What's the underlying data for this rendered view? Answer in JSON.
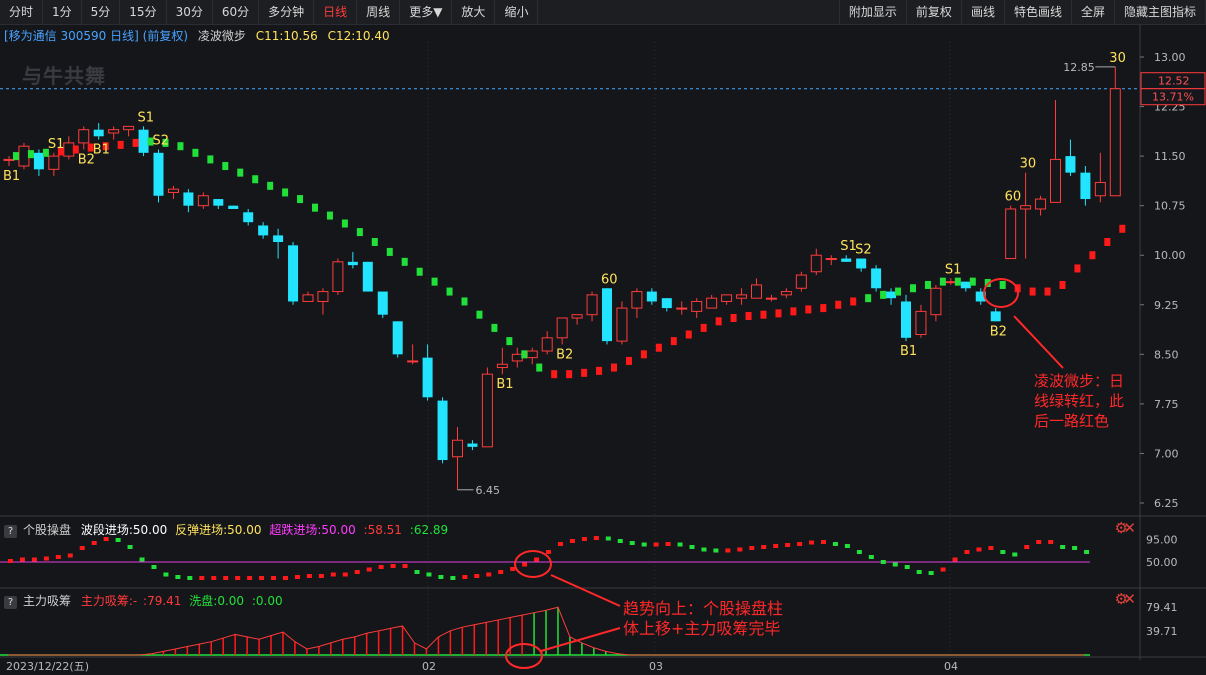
{
  "toolbar": {
    "left": [
      "分时",
      "1分",
      "5分",
      "15分",
      "30分",
      "60分",
      "多分钟",
      "日线",
      "周线",
      "更多▼",
      "放大",
      "缩小"
    ],
    "active": "日线",
    "right": [
      "附加显示",
      "前复权",
      "画线",
      "特色画线",
      "全屏",
      "隐藏主图指标"
    ]
  },
  "title": {
    "stock": "[移为通信 300590 日线]",
    "adjust": "(前复权)",
    "indicator": "凌波微步",
    "c1": "C11:10.56",
    "c2": "C12:10.40"
  },
  "watermark": "与牛共舞",
  "price_axis": {
    "ticks": [
      "13.00",
      "12.25",
      "11.50",
      "10.75",
      "10.00",
      "9.25",
      "8.50",
      "7.75",
      "7.00",
      "6.25"
    ],
    "current": "12.52",
    "change": "13.71%"
  },
  "labels": {
    "high": "12.85",
    "low": "6.45"
  },
  "annotations": {
    "main": [
      "凌波微步：日",
      "线绿转红，此",
      "后一路红色"
    ],
    "sub": [
      "趋势向上：个股操盘柱",
      "体上移+主力吸筹完毕"
    ]
  },
  "sub1": {
    "name": "个股操盘",
    "text1": "波段进场:50.00",
    "text2": "反弹进场:50.00",
    "text3": "超跌进场:50.00",
    "v1": ":58.51",
    "v2": ":62.89",
    "axis": [
      "95.00",
      "50.00"
    ]
  },
  "sub2": {
    "name": "主力吸筹",
    "text1": "主力吸筹:-",
    "v1": ":79.41",
    "text2": "洗盘:0.00",
    "v2": ":0.00",
    "axis": [
      "79.41",
      "39.71"
    ]
  },
  "date_axis": [
    "2023/12/22(五)",
    "02",
    "03",
    "04"
  ],
  "colors": {
    "up": "#ff3b3b",
    "down": "#22e4ff",
    "green": "#22e03a",
    "red": "#ff1a1a",
    "accent": "#ff3b3b"
  },
  "chart_data": [
    {
      "type": "candlestick",
      "title": "移为通信 300590 日线",
      "ylim": [
        6.25,
        13.0
      ],
      "ohlc": [
        [
          11.45,
          11.5,
          11.35,
          11.45
        ],
        [
          11.35,
          11.7,
          11.3,
          11.65
        ],
        [
          11.55,
          11.6,
          11.2,
          11.3
        ],
        [
          11.3,
          11.55,
          11.2,
          11.5
        ],
        [
          11.5,
          11.8,
          11.45,
          11.7
        ],
        [
          11.7,
          11.95,
          11.6,
          11.9
        ],
        [
          11.9,
          12.0,
          11.75,
          11.8
        ],
        [
          11.85,
          11.95,
          11.75,
          11.9
        ],
        [
          11.9,
          11.95,
          11.8,
          11.95
        ],
        [
          11.9,
          11.95,
          11.5,
          11.55
        ],
        [
          11.55,
          11.6,
          10.8,
          10.9
        ],
        [
          10.95,
          11.05,
          10.85,
          11.0
        ],
        [
          10.95,
          11.0,
          10.65,
          10.75
        ],
        [
          10.75,
          10.95,
          10.7,
          10.9
        ],
        [
          10.85,
          10.85,
          10.7,
          10.75
        ],
        [
          10.75,
          10.75,
          10.7,
          10.7
        ],
        [
          10.65,
          10.7,
          10.45,
          10.5
        ],
        [
          10.45,
          10.5,
          10.25,
          10.3
        ],
        [
          10.3,
          10.4,
          9.95,
          10.2
        ],
        [
          10.15,
          10.2,
          9.25,
          9.3
        ],
        [
          9.3,
          9.45,
          9.3,
          9.4
        ],
        [
          9.3,
          9.5,
          9.1,
          9.45
        ],
        [
          9.45,
          9.95,
          9.4,
          9.9
        ],
        [
          9.9,
          10.05,
          9.8,
          9.85
        ],
        [
          9.9,
          9.9,
          9.45,
          9.45
        ],
        [
          9.45,
          9.45,
          9.05,
          9.1
        ],
        [
          9.0,
          9.0,
          8.45,
          8.5
        ],
        [
          8.4,
          8.65,
          8.35,
          8.4
        ],
        [
          8.45,
          8.65,
          7.8,
          7.85
        ],
        [
          7.8,
          7.85,
          6.85,
          6.9
        ],
        [
          6.95,
          7.4,
          6.45,
          7.2
        ],
        [
          7.15,
          7.2,
          7.05,
          7.1
        ],
        [
          7.1,
          8.3,
          7.1,
          8.2
        ],
        [
          8.3,
          8.6,
          8.2,
          8.35
        ],
        [
          8.4,
          8.6,
          8.3,
          8.5
        ],
        [
          8.45,
          8.6,
          8.35,
          8.55
        ],
        [
          8.55,
          8.85,
          8.5,
          8.75
        ],
        [
          8.75,
          9.05,
          8.65,
          9.05
        ],
        [
          9.05,
          9.1,
          8.95,
          9.1
        ],
        [
          9.1,
          9.45,
          9.0,
          9.4
        ],
        [
          9.5,
          9.5,
          8.65,
          8.7
        ],
        [
          8.7,
          9.3,
          8.65,
          9.2
        ],
        [
          9.2,
          9.5,
          9.05,
          9.45
        ],
        [
          9.45,
          9.5,
          9.25,
          9.3
        ],
        [
          9.35,
          9.35,
          9.15,
          9.2
        ],
        [
          9.2,
          9.3,
          9.1,
          9.2
        ],
        [
          9.15,
          9.35,
          9.05,
          9.3
        ],
        [
          9.2,
          9.4,
          9.2,
          9.35
        ],
        [
          9.3,
          9.4,
          9.25,
          9.4
        ],
        [
          9.35,
          9.5,
          9.25,
          9.4
        ],
        [
          9.35,
          9.65,
          9.35,
          9.55
        ],
        [
          9.35,
          9.4,
          9.3,
          9.35
        ],
        [
          9.4,
          9.5,
          9.35,
          9.45
        ],
        [
          9.5,
          9.75,
          9.45,
          9.7
        ],
        [
          9.75,
          10.1,
          9.7,
          10.0
        ],
        [
          9.95,
          10.0,
          9.85,
          9.95
        ],
        [
          9.95,
          10.0,
          9.9,
          9.9
        ],
        [
          9.95,
          9.95,
          9.75,
          9.8
        ],
        [
          9.8,
          9.85,
          9.45,
          9.5
        ],
        [
          9.45,
          9.5,
          9.25,
          9.35
        ],
        [
          9.3,
          9.4,
          8.7,
          8.75
        ],
        [
          8.8,
          9.25,
          8.75,
          9.15
        ],
        [
          9.1,
          9.55,
          9.0,
          9.5
        ],
        [
          9.6,
          9.65,
          9.55,
          9.6
        ],
        [
          9.6,
          9.6,
          9.45,
          9.5
        ],
        [
          9.45,
          9.5,
          9.25,
          9.3
        ],
        [
          9.15,
          9.2,
          9.0,
          9.0
        ],
        [
          9.95,
          10.75,
          9.95,
          10.7
        ],
        [
          10.7,
          11.25,
          9.95,
          10.75
        ],
        [
          10.7,
          10.9,
          10.6,
          10.85
        ],
        [
          10.8,
          12.35,
          10.8,
          11.45
        ],
        [
          11.5,
          11.75,
          11.2,
          11.25
        ],
        [
          11.25,
          11.35,
          10.75,
          10.85
        ],
        [
          10.9,
          11.55,
          10.8,
          11.1
        ],
        [
          10.9,
          12.85,
          10.9,
          12.52
        ]
      ],
      "lingbo_line": [
        11.5,
        11.53,
        11.55,
        11.57,
        11.6,
        11.63,
        11.65,
        11.67,
        11.7,
        11.72,
        11.7,
        11.65,
        11.55,
        11.45,
        11.35,
        11.25,
        11.15,
        11.05,
        10.95,
        10.85,
        10.72,
        10.6,
        10.48,
        10.35,
        10.2,
        10.05,
        9.9,
        9.75,
        9.6,
        9.45,
        9.3,
        9.1,
        8.9,
        8.7,
        8.5,
        8.3,
        8.2,
        8.2,
        8.22,
        8.25,
        8.3,
        8.4,
        8.5,
        8.6,
        8.7,
        8.8,
        8.9,
        9.0,
        9.05,
        9.08,
        9.1,
        9.12,
        9.15,
        9.18,
        9.2,
        9.25,
        9.3,
        9.35,
        9.4,
        9.45,
        9.5,
        9.55,
        9.6,
        9.6,
        9.6,
        9.58,
        9.55,
        9.5,
        9.45,
        9.45,
        9.55,
        9.8,
        10.0,
        10.2,
        10.4
      ],
      "lingbo_color": [
        "g",
        "g",
        "g",
        "r",
        "r",
        "r",
        "r",
        "r",
        "r",
        "g",
        "g",
        "g",
        "g",
        "g",
        "g",
        "g",
        "g",
        "g",
        "g",
        "g",
        "g",
        "g",
        "g",
        "g",
        "g",
        "g",
        "g",
        "g",
        "g",
        "g",
        "g",
        "g",
        "g",
        "g",
        "g",
        "g",
        "r",
        "r",
        "r",
        "r",
        "r",
        "r",
        "r",
        "r",
        "r",
        "r",
        "r",
        "r",
        "r",
        "r",
        "r",
        "r",
        "r",
        "r",
        "r",
        "r",
        "r",
        "g",
        "g",
        "g",
        "g",
        "g",
        "g",
        "g",
        "g",
        "g",
        "g",
        "r",
        "r",
        "r",
        "r",
        "r",
        "r",
        "r",
        "r"
      ],
      "signals": [
        {
          "i": 0,
          "text": "B1",
          "pos": "below"
        },
        {
          "i": 3,
          "text": "S1",
          "pos": "above"
        },
        {
          "i": 5,
          "text": "B2",
          "pos": "below"
        },
        {
          "i": 6,
          "text": "B1",
          "pos": "below"
        },
        {
          "i": 9,
          "text": "S1",
          "pos": "above"
        },
        {
          "i": 10,
          "text": "S2",
          "pos": "above"
        },
        {
          "i": 33,
          "text": "B1",
          "pos": "below"
        },
        {
          "i": 37,
          "text": "B2",
          "pos": "below"
        },
        {
          "i": 40,
          "text": "60",
          "pos": "above"
        },
        {
          "i": 56,
          "text": "S1",
          "pos": "above"
        },
        {
          "i": 57,
          "text": "S2",
          "pos": "above"
        },
        {
          "i": 60,
          "text": "B1",
          "pos": "below"
        },
        {
          "i": 63,
          "text": "S1",
          "pos": "above"
        },
        {
          "i": 66,
          "text": "B2",
          "pos": "below"
        },
        {
          "i": 67,
          "text": "60",
          "pos": "above"
        },
        {
          "i": 68,
          "text": "30",
          "pos": "above"
        },
        {
          "i": 74,
          "text": "30",
          "pos": "above"
        }
      ]
    },
    {
      "type": "scatter",
      "title": "个股操盘",
      "ylim": [
        0,
        100
      ],
      "values": [
        52,
        55,
        55,
        57,
        60,
        63,
        78,
        88,
        96,
        94,
        80,
        55,
        40,
        25,
        20,
        18,
        18,
        18,
        18,
        18,
        18,
        18,
        18,
        18,
        20,
        22,
        22,
        25,
        25,
        30,
        35,
        40,
        42,
        42,
        30,
        25,
        20,
        18,
        20,
        22,
        25,
        30,
        36,
        45,
        55,
        70,
        86,
        92,
        96,
        98,
        97,
        92,
        88,
        85,
        85,
        86,
        85,
        80,
        75,
        73,
        73,
        75,
        78,
        80,
        82,
        84,
        86,
        89,
        90,
        86,
        82,
        70,
        60,
        50,
        45,
        40,
        30,
        28,
        35,
        55,
        70,
        75,
        78,
        70,
        65,
        80,
        90,
        90,
        80,
        78,
        70
      ]
    },
    {
      "type": "bar",
      "title": "主力吸筹",
      "ylim": [
        0,
        79.41
      ],
      "values": [
        0,
        0,
        0,
        0,
        0,
        0,
        0,
        0,
        0,
        0,
        0,
        0,
        2,
        6,
        10,
        14,
        18,
        22,
        28,
        34,
        30,
        26,
        32,
        38,
        22,
        10,
        14,
        20,
        26,
        30,
        36,
        40,
        44,
        48,
        20,
        10,
        30,
        40,
        46,
        50,
        54,
        58,
        62,
        66,
        70,
        74,
        79,
        30,
        20,
        12,
        6,
        2,
        0,
        0,
        0,
        0,
        0,
        0,
        0,
        0,
        0,
        0,
        0,
        0,
        0,
        0,
        0,
        0,
        0,
        0,
        0,
        0,
        0,
        0,
        0,
        0,
        0,
        0,
        0,
        0,
        0,
        0,
        0,
        0,
        0,
        0,
        0,
        0,
        0,
        0,
        0
      ]
    }
  ]
}
